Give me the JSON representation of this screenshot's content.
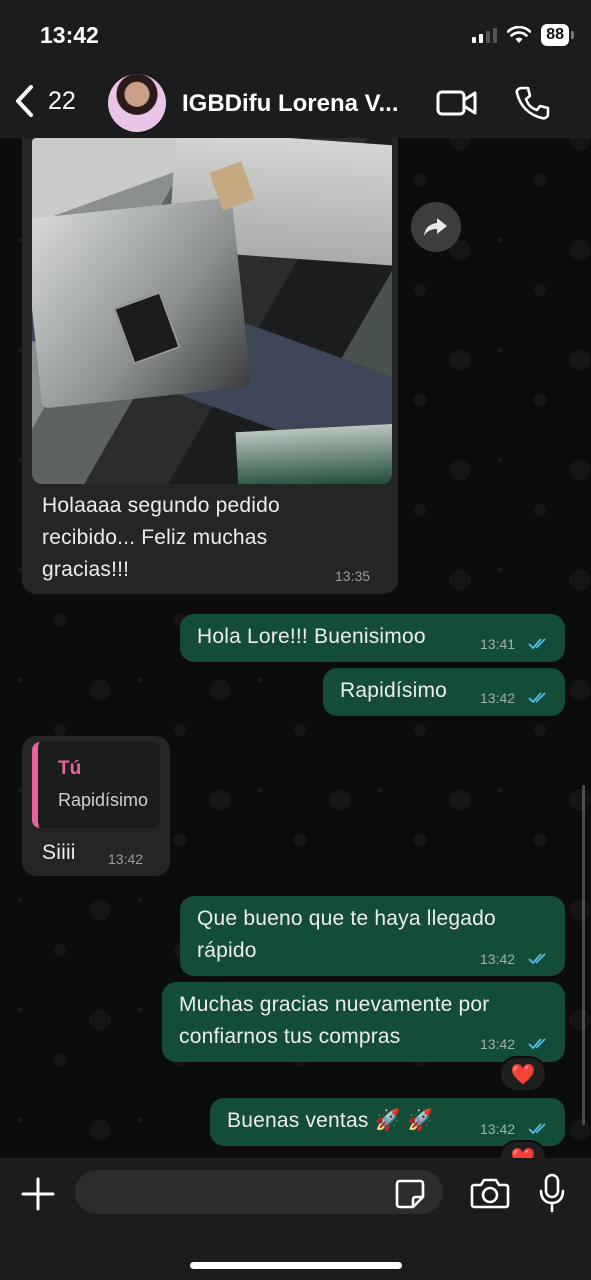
{
  "status_bar": {
    "time": "13:42",
    "battery": "88"
  },
  "header": {
    "back_count": "22",
    "contact_name": "IGBDifu Lorena V..."
  },
  "messages": [
    {
      "direction": "in",
      "text_lines": [
        "Holaaaa segundo pedido",
        "recibido... Feliz muchas",
        "gracias!!!"
      ],
      "time": "13:35",
      "has_image": true
    },
    {
      "direction": "out",
      "text": "Hola Lore!!! Buenisimoo",
      "time": "13:41",
      "status": "read"
    },
    {
      "direction": "out",
      "text": "Rapidísimo",
      "time": "13:42",
      "status": "read"
    },
    {
      "direction": "in",
      "quote_author": "Tú",
      "quote_text": "Rapidísimo",
      "text": "Siiii",
      "time": "13:42"
    },
    {
      "direction": "out",
      "text_lines": [
        "Que bueno que te haya llegado",
        "rápido"
      ],
      "time": "13:42",
      "status": "read"
    },
    {
      "direction": "out",
      "text_lines": [
        "Muchas gracias nuevamente por",
        "confiarnos tus compras"
      ],
      "time": "13:42",
      "status": "read",
      "reaction": "❤️"
    },
    {
      "direction": "out",
      "text": "Buenas ventas 🚀 🚀",
      "time": "13:42",
      "status": "read",
      "reaction": "❤️"
    }
  ],
  "colors": {
    "incoming_bubble": "#242626",
    "outgoing_bubble": "#144d37",
    "read_ticks": "#53bdeb",
    "quote_accent": "#e7659b"
  }
}
